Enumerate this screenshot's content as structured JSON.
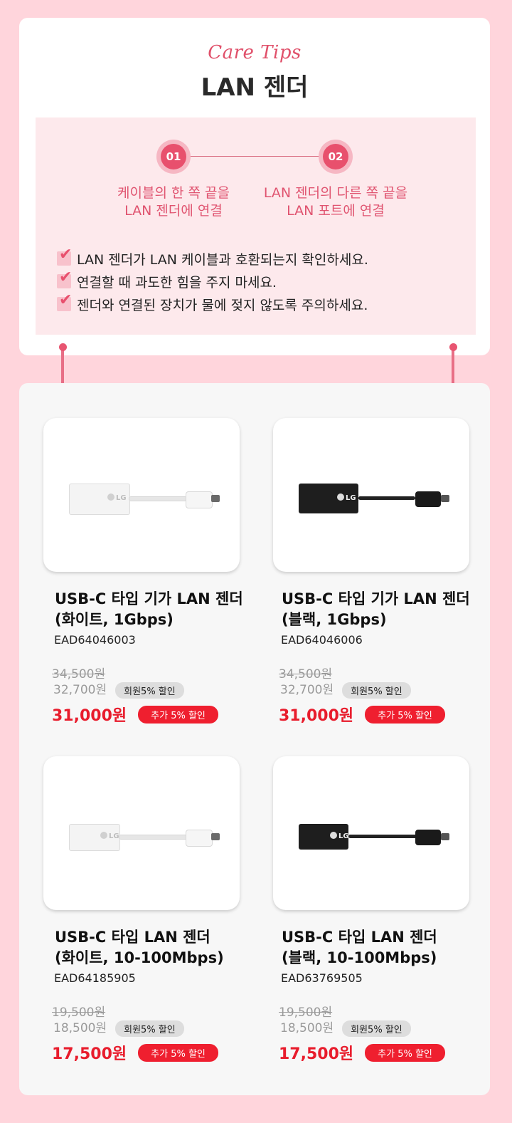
{
  "tips": {
    "care_label": "Care Tips",
    "title": "LAN 젠더",
    "steps": [
      {
        "number": "01",
        "line1": "케이블의 한 쪽 끝을",
        "line2": "LAN 젠더에 연결"
      },
      {
        "number": "02",
        "line1": "LAN 젠더의 다른 쪽 끝을",
        "line2": "LAN 포트에 연결"
      }
    ],
    "checklist": [
      "LAN 젠더가 LAN 케이블과 호환되는지 확인하세요.",
      "연결할 때 과도한 힘을 주지 마세요.",
      "젠더와 연결된 장치가 물에 젖지 않도록 주의하세요."
    ]
  },
  "products": [
    {
      "name": "USB-C 타입 기가 LAN 젠더\n(화이트, 1Gbps)",
      "code": "EAD64046003",
      "original_price": "34,500원",
      "member_price": "32,700원",
      "member_badge": "회원5% 할인",
      "final_price": "31,000원",
      "extra_badge": "추가 5% 할인",
      "image_icon": "lan-adapter-white-icon",
      "image_logo": "LG"
    },
    {
      "name": "USB-C 타입 기가 LAN 젠더\n(블랙, 1Gbps)",
      "code": "EAD64046006",
      "original_price": "34,500원",
      "member_price": "32,700원",
      "member_badge": "회원5% 할인",
      "final_price": "31,000원",
      "extra_badge": "추가 5% 할인",
      "image_icon": "lan-adapter-black-icon",
      "image_logo": "LG"
    },
    {
      "name": "USB-C 타입 LAN 젠더\n(화이트, 10-100Mbps)",
      "code": "EAD64185905",
      "original_price": "19,500원",
      "member_price": "18,500원",
      "member_badge": "회원5% 할인",
      "final_price": "17,500원",
      "extra_badge": "추가 5% 할인",
      "image_icon": "lan-adapter-white-icon",
      "image_logo": "LG"
    },
    {
      "name": "USB-C 타입 LAN 젠더\n(블랙, 10-100Mbps)",
      "code": "EAD63769505",
      "original_price": "19,500원",
      "member_price": "18,500원",
      "member_badge": "회원5% 할인",
      "final_price": "17,500원",
      "extra_badge": "추가 5% 할인",
      "image_icon": "lan-adapter-black-icon",
      "image_logo": "LG"
    }
  ],
  "colors": {
    "page_background": "#ffd5dc",
    "accent_pink": "#e8506d",
    "sale_red": "#e81c2c"
  }
}
